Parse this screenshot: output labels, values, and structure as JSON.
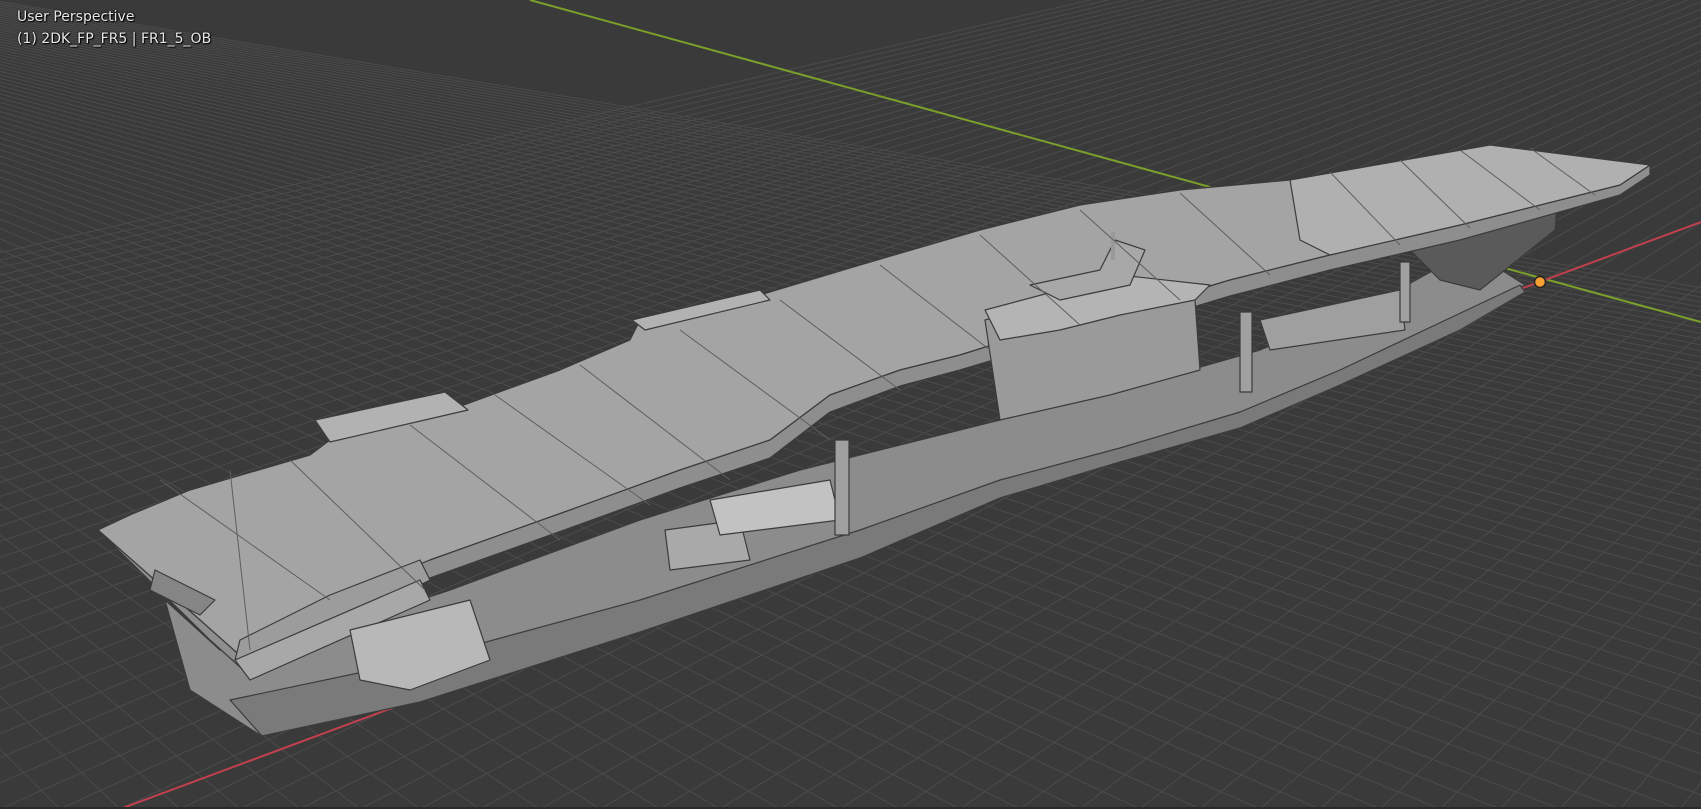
{
  "viewport": {
    "view_name": "User Perspective",
    "object_info": "(1) 2DK_FP_FR5 | FR1_5_OB"
  },
  "colors": {
    "background": "#3a3a3a",
    "grid_line": "#4a4a4a",
    "x_axis": "#c0404e",
    "y_axis": "#7aa02a",
    "hull_light": "#a3a3a3",
    "hull_mid": "#8a8a8a",
    "hull_dark": "#6e6e6e",
    "edge": "#3b3b3b",
    "origin_dot": "#f5a033"
  },
  "icons": {
    "origin": "object-origin-icon"
  }
}
